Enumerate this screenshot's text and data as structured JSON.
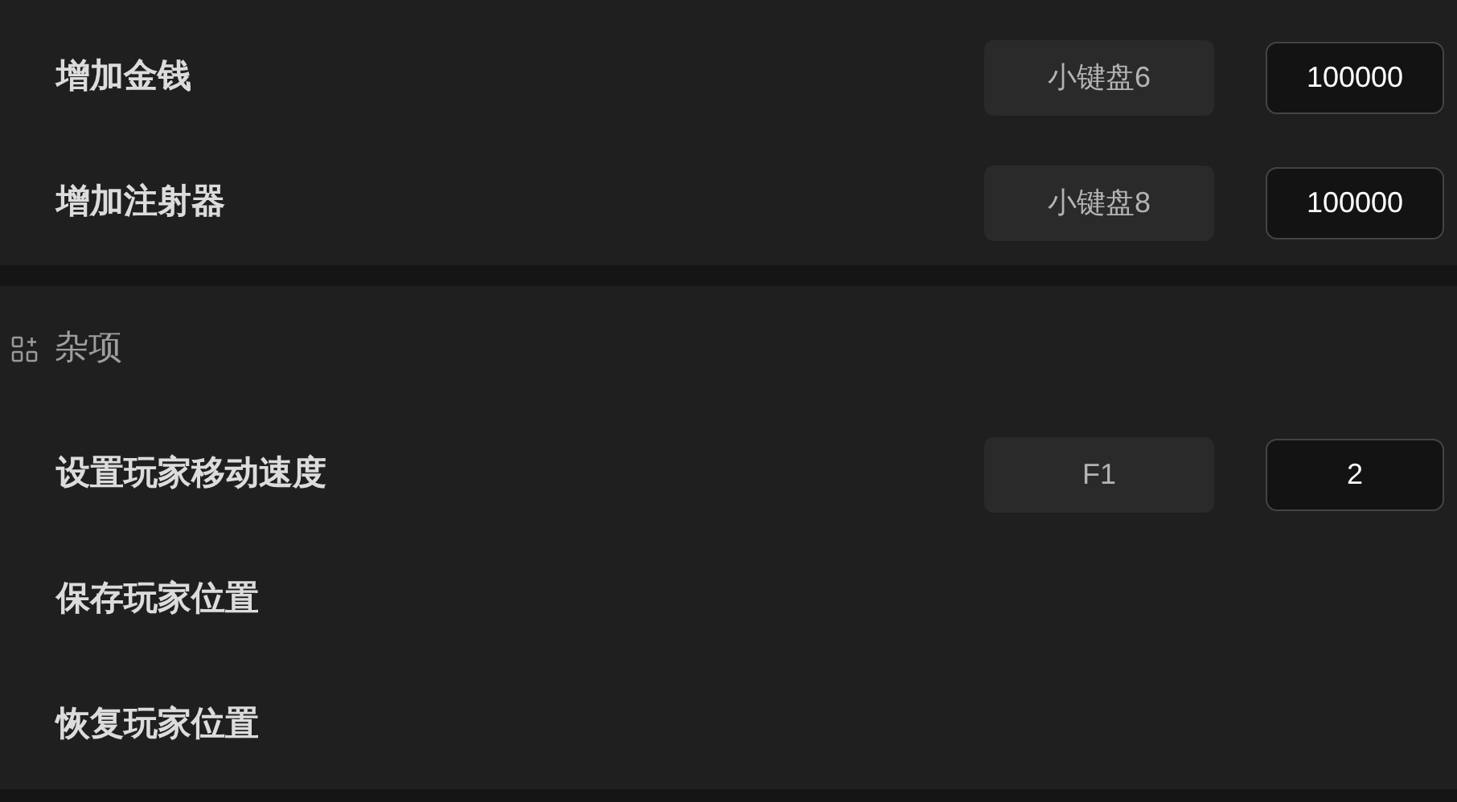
{
  "sections": [
    {
      "items": [
        {
          "label": "增加金钱",
          "hotkey": "小键盘6",
          "value": "100000"
        },
        {
          "label": "增加注射器",
          "hotkey": "小键盘8",
          "value": "100000"
        }
      ]
    },
    {
      "title": "杂项",
      "items": [
        {
          "label": "设置玩家移动速度",
          "hotkey": "F1",
          "value": "2"
        },
        {
          "label": "保存玩家位置"
        },
        {
          "label": "恢复玩家位置"
        }
      ]
    }
  ]
}
